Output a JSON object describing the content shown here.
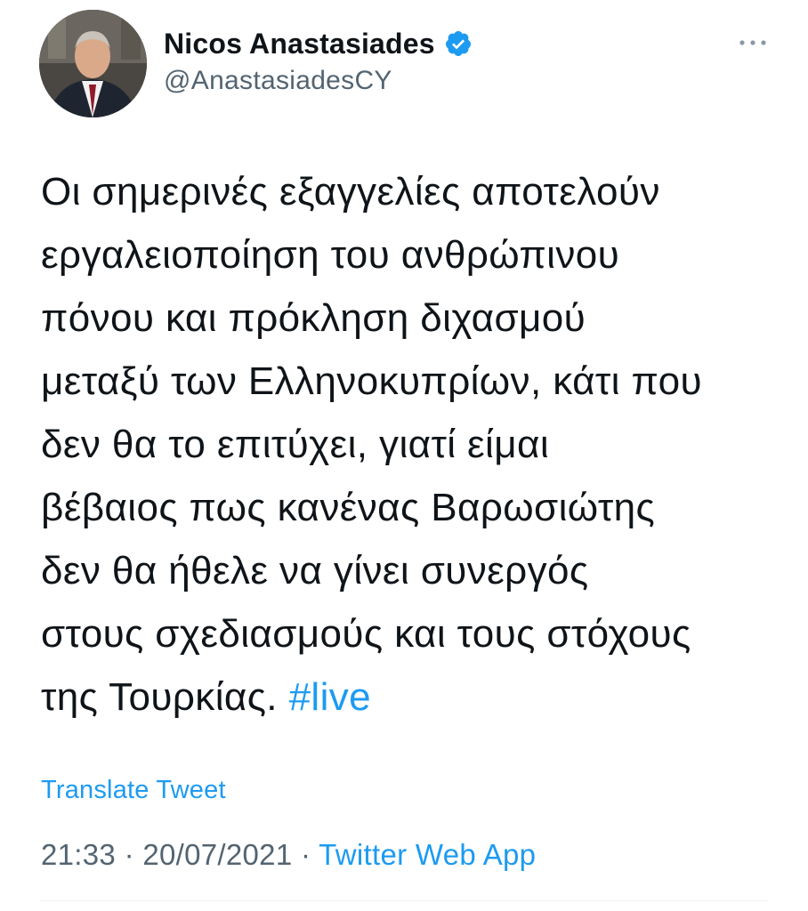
{
  "author": {
    "display_name": "Nicos Anastasiades",
    "handle": "@AnastasiadesCY",
    "verified_icon": "verified-badge-icon",
    "avatar_icon": "avatar-photo"
  },
  "tweet": {
    "text_lines": [
      "Οι σημερινές εξαγγελίες αποτελούν",
      "εργαλειοποίηση του ανθρώπινου",
      "πόνου και πρόκληση διχασμού",
      "μεταξύ των Ελληνοκυπρίων, κάτι που",
      "δεν θα το επιτύχει, γιατί είμαι",
      "βέβαιος πως κανένας Βαρωσιώτης",
      "δεν θα ήθελε να γίνει συνεργός",
      "στους σχεδιασμούς και τους στόχους",
      "της Τουρκίας."
    ],
    "hashtag": "#live",
    "translate_label": "Translate Tweet",
    "time": "21:33",
    "separator": "·",
    "date": "20/07/2021",
    "source": "Twitter Web App"
  },
  "colors": {
    "accent": "#1d9bf0",
    "text": "#0f1419",
    "secondary": "#536471"
  },
  "more_icon": "more-options-icon"
}
